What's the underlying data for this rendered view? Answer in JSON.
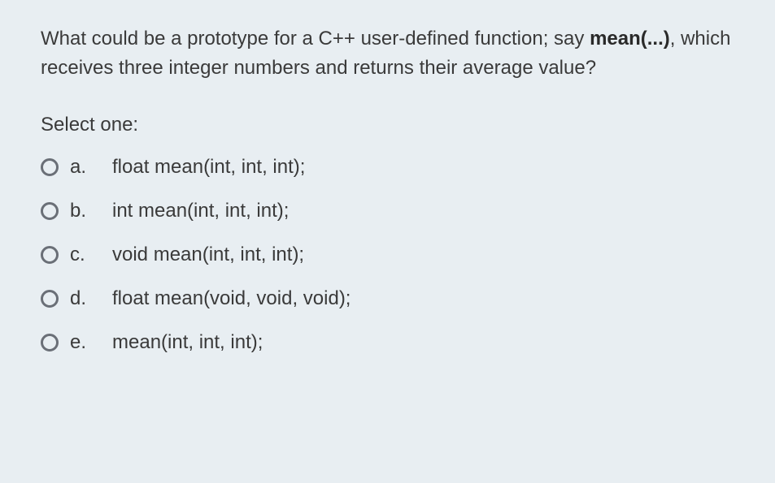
{
  "question": {
    "part1": "What could be a prototype for a C++ user-defined function; say ",
    "bold": "mean(...)",
    "part2": ", which receives three integer numbers and returns their average value?"
  },
  "select_label": "Select one:",
  "options": [
    {
      "letter": "a.",
      "text": "float mean(int, int, int);"
    },
    {
      "letter": "b.",
      "text": "int mean(int, int, int);"
    },
    {
      "letter": "c.",
      "text": "void mean(int, int, int);"
    },
    {
      "letter": "d.",
      "text": "float mean(void, void, void);"
    },
    {
      "letter": "e.",
      "text": "mean(int, int, int);"
    }
  ]
}
